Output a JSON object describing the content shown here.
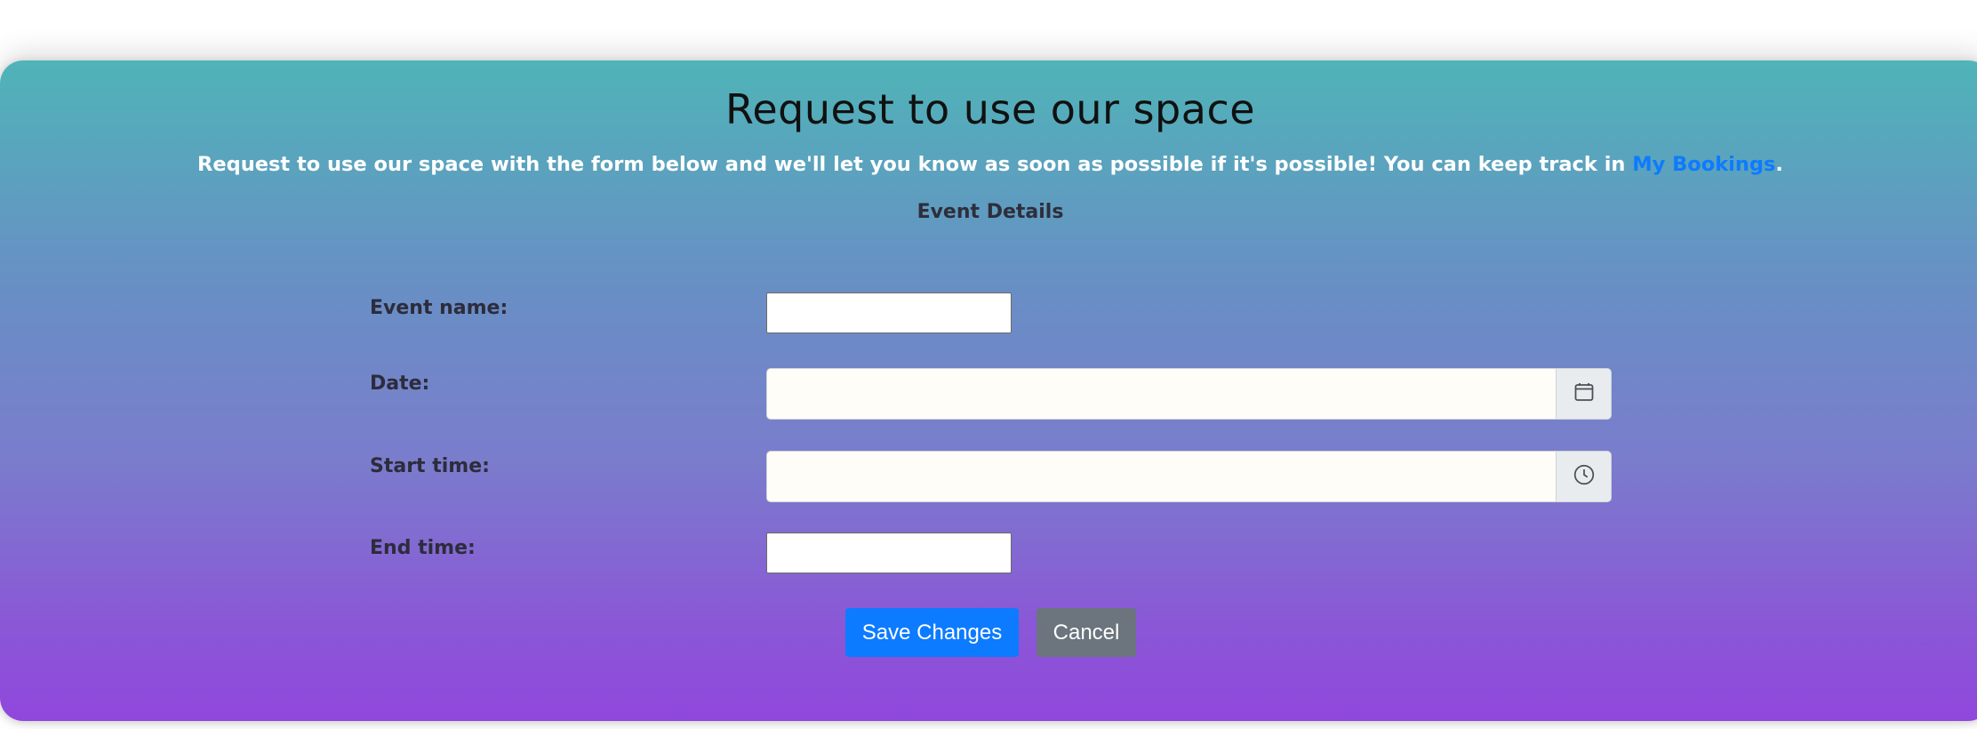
{
  "header": {
    "title": "Request to use our space",
    "subtitle_pre": "Request to use our space with the form below and we'll let you know as soon as possible if it's possible! You can keep track in ",
    "subtitle_link": "My Bookings",
    "subtitle_post": "."
  },
  "form": {
    "section_title": "Event Details",
    "event_name_label": "Event name:",
    "event_name_value": "",
    "date_label": "Date:",
    "date_value": "",
    "start_time_label": "Start time:",
    "start_time_value": "",
    "end_time_label": "End time:",
    "end_time_value": ""
  },
  "actions": {
    "save_label": "Save Changes",
    "cancel_label": "Cancel"
  },
  "icons": {
    "date_addon": "calendar-icon",
    "time_addon": "clock-icon"
  },
  "colors": {
    "gradient_top": "#4fb4b8",
    "gradient_bottom": "#9047dc",
    "link": "#0d7bff",
    "primary_button": "#0d7bff",
    "secondary_button": "#6c757d"
  }
}
